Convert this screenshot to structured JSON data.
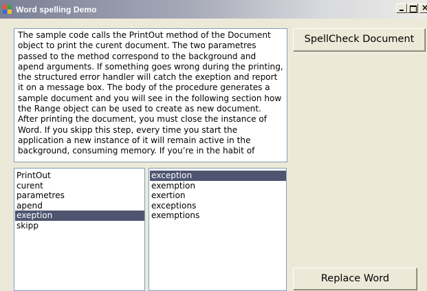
{
  "window": {
    "title": "Word spelling Demo",
    "colors": {
      "titlebar_start": "#7b7f96",
      "titlebar_end": "#ecebe6",
      "face": "#ece9d8",
      "selection": "#4f5570"
    }
  },
  "document_text": {
    "paragraph1": "The sample code calls the PrintOut method of the Document object to print the curent document. The two parametres passed to the method correspond to the background and apend arguments. If something goes wrong during the printing, the structured error handler will catch the exeption and report it on a message box. The body of the procedure generates a sample document and you will see in the following section how the Range object can be used to create as new document.",
    "paragraph2": "After printing the document, you must close the instance of Word. If you skipp this step, every time you start the application a new instance of it will remain active in the background, consuming memory. If you’re in the habit of"
  },
  "buttons": {
    "spellcheck": "SpellCheck Document",
    "replace": "Replace Word"
  },
  "misspelled_list": {
    "items": [
      "PrintOut",
      "curent",
      "parametres",
      "apend",
      "exeption",
      "skipp"
    ],
    "selected": "exeption"
  },
  "suggestions_list": {
    "items": [
      "exception",
      "exemption",
      "exertion",
      "exceptions",
      "exemptions"
    ],
    "selected": "exception"
  },
  "icons": {
    "app": "windows-app-icon",
    "minimize": "minimize-icon",
    "maximize": "maximize-icon",
    "close": "close-icon"
  }
}
